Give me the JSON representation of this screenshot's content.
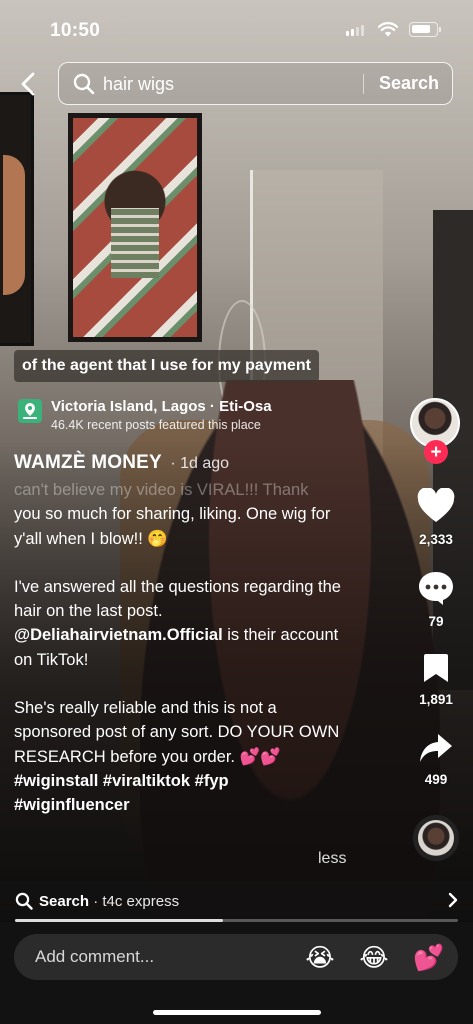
{
  "status_bar": {
    "time": "10:50"
  },
  "search": {
    "query": "hair wigs",
    "button_label": "Search"
  },
  "video": {
    "subtitle": "of the agent that I use for my payment",
    "location_name": "Victoria Island, Lagos · Eti-Osa",
    "location_sub": "46.4K recent posts featured this place",
    "author": "WAMZÈ MONEY",
    "post_date": "· 1d ago",
    "description": {
      "faded_line": "can't believe my video is VIRAL!!! Thank",
      "p1": "you so much for sharing, liking. One wig for y'all when I blow!! 🤭",
      "p2_before": "I've answered all the questions regarding the hair on the last post. ",
      "mention": "@Deliahairvietnam.Official",
      "p2_after": " is their account on TikTok!",
      "p3": "She's really reliable and this is not a sponsored post of any sort. DO YOUR OWN RESEARCH before you order. 💕💕",
      "hashtags": "#wiginstall #viraltiktok #fyp #wiginfluencer"
    },
    "less_label": "less",
    "progress_fraction": 0.47
  },
  "actions": {
    "likes": "2,333",
    "comments": "79",
    "saves": "1,891",
    "shares": "499",
    "follow_symbol": "+"
  },
  "related_search": {
    "label": "Search",
    "query": " · t4c express"
  },
  "comment_bar": {
    "placeholder": "Add comment...",
    "emojis": [
      "😭",
      "😂",
      "💕"
    ]
  },
  "colors": {
    "accent": "#fe2c55",
    "location_badge": "#3bb27a"
  },
  "icons": [
    "back-arrow-icon",
    "search-icon",
    "heart-icon",
    "comment-icon",
    "bookmark-icon",
    "share-icon",
    "chevron-right-icon",
    "location-pin-icon"
  ]
}
